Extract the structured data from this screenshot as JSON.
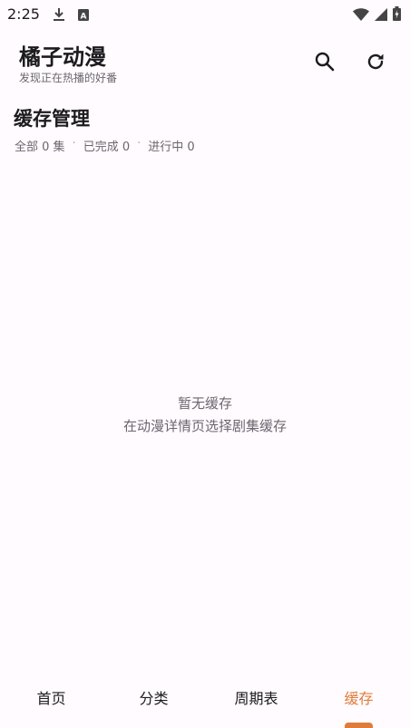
{
  "status_bar": {
    "time": "2:25",
    "left_icons": [
      "download-icon",
      "a-notification-icon"
    ],
    "right_icons": [
      "wifi-icon",
      "cellular-signal-icon",
      "battery-icon"
    ]
  },
  "header": {
    "title": "橘子动漫",
    "subtitle": "发现正在热播的好番",
    "actions": [
      "search-icon",
      "refresh-icon"
    ]
  },
  "cache": {
    "title": "缓存管理",
    "stats": {
      "all": "全部 0 集",
      "done": "已完成 0",
      "in_progress": "进行中 0",
      "separator": "·"
    },
    "empty_title": "暂无缓存",
    "empty_desc": "在动漫详情页选择剧集缓存"
  },
  "bottom_nav": {
    "items": [
      {
        "label": "首页"
      },
      {
        "label": "分类"
      },
      {
        "label": "周期表"
      },
      {
        "label": "缓存"
      }
    ],
    "active_index": 3
  },
  "colors": {
    "accent": "#e07b39",
    "background": "#fffbfe",
    "text_primary": "#1c1b1f",
    "text_secondary": "#6b6670"
  }
}
